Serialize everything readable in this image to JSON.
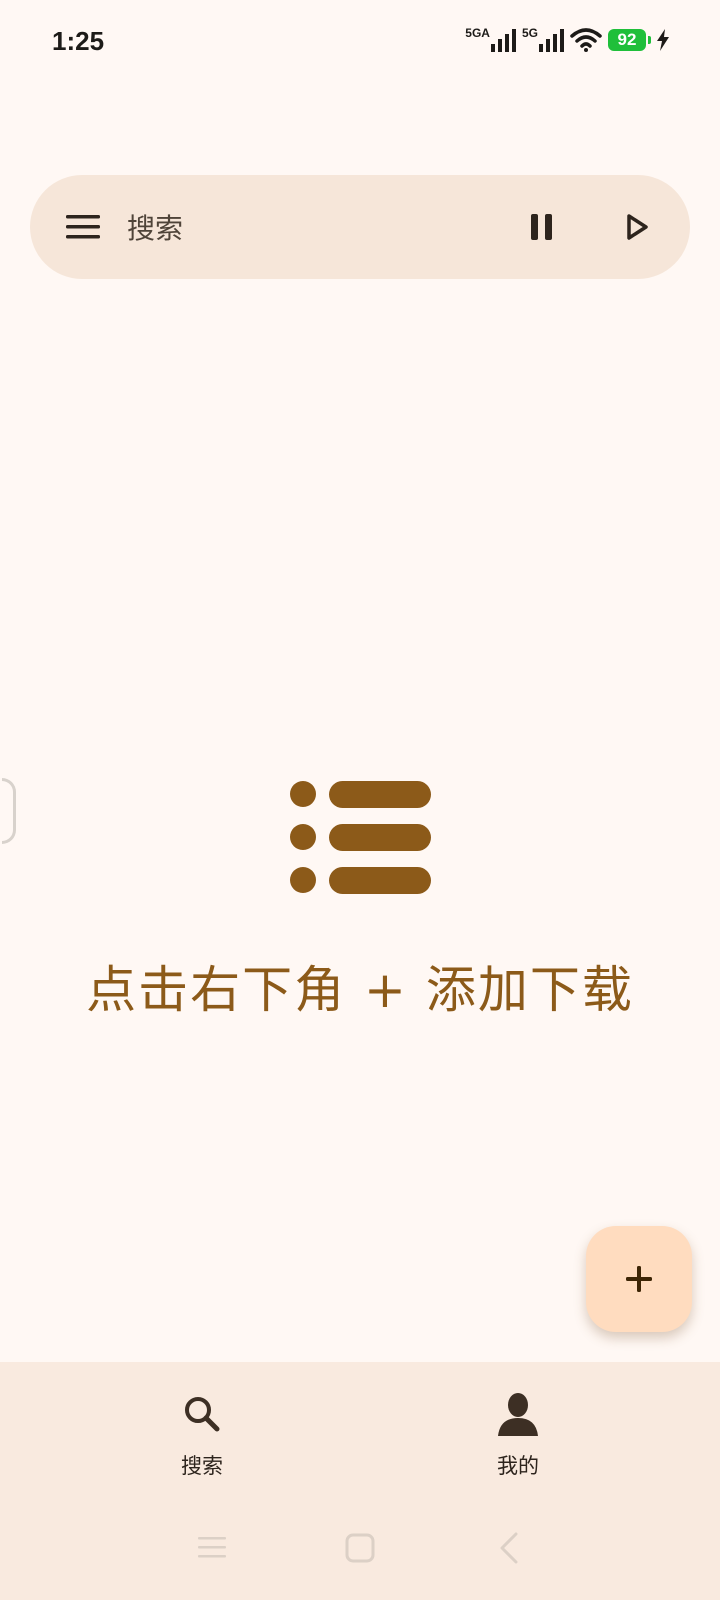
{
  "status_bar": {
    "time": "1:25",
    "network_1": "5GA",
    "network_2": "5G",
    "battery_level": "92",
    "icons": [
      "signal-icon",
      "signal-icon",
      "wifi-icon",
      "battery-icon",
      "charging-icon"
    ]
  },
  "search_bar": {
    "placeholder": "搜索",
    "icons": [
      "menu-icon",
      "pause-icon",
      "play-icon"
    ]
  },
  "empty_state": {
    "icon": "list-icon",
    "hint": "点击右下角 + 添加下载"
  },
  "fab": {
    "icon": "plus-icon"
  },
  "bottom_nav": {
    "items": [
      {
        "label": "搜索",
        "icon": "search-icon"
      },
      {
        "label": "我的",
        "icon": "person-icon"
      }
    ]
  },
  "system_nav": {
    "icons": [
      "recents-icon",
      "home-icon",
      "back-icon"
    ]
  },
  "colors": {
    "background": "#fff8f4",
    "search_bar": "#f6e6d9",
    "accent_brown": "#8c5a19",
    "fab": "#ffdcbf",
    "bottom_nav": "#f9eadf",
    "battery": "#1fbf3a"
  }
}
